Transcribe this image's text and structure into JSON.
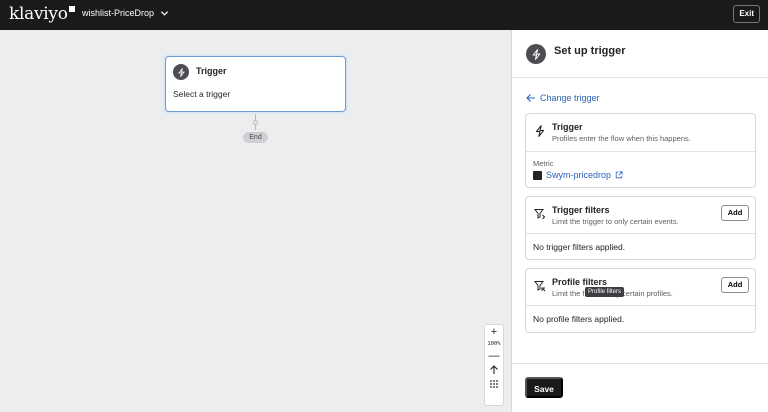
{
  "header": {
    "logo_text": "klaviyo",
    "flow_name": "wishlist-PriceDrop",
    "exit_label": "Exit"
  },
  "canvas": {
    "trigger_card": {
      "title": "Trigger",
      "subtitle": "Select a trigger"
    },
    "end_label": "End",
    "zoom": {
      "zoom_in": "+",
      "zoom_level": "100%",
      "zoom_out": "—"
    }
  },
  "panel": {
    "title": "Set up trigger",
    "change_trigger": "Change trigger",
    "trigger_box": {
      "title": "Trigger",
      "description": "Profiles enter the flow when this happens.",
      "metric_label": "Metric",
      "metric_value": "Swym-pricedrop"
    },
    "trigger_filters": {
      "title": "Trigger filters",
      "description": "Limit the trigger to only certain events.",
      "add_label": "Add",
      "empty_text": "No trigger filters applied."
    },
    "profile_filters": {
      "title": "Profile filters",
      "description": "Limit the flow to only certain profiles.",
      "add_label": "Add",
      "empty_text": "No profile filters applied.",
      "tooltip": "Profile filters"
    },
    "save_label": "Save"
  },
  "icons": {
    "trigger": "bolt-icon",
    "filter": "filter-icon",
    "back": "arrow-left-icon",
    "external": "external-link-icon"
  }
}
